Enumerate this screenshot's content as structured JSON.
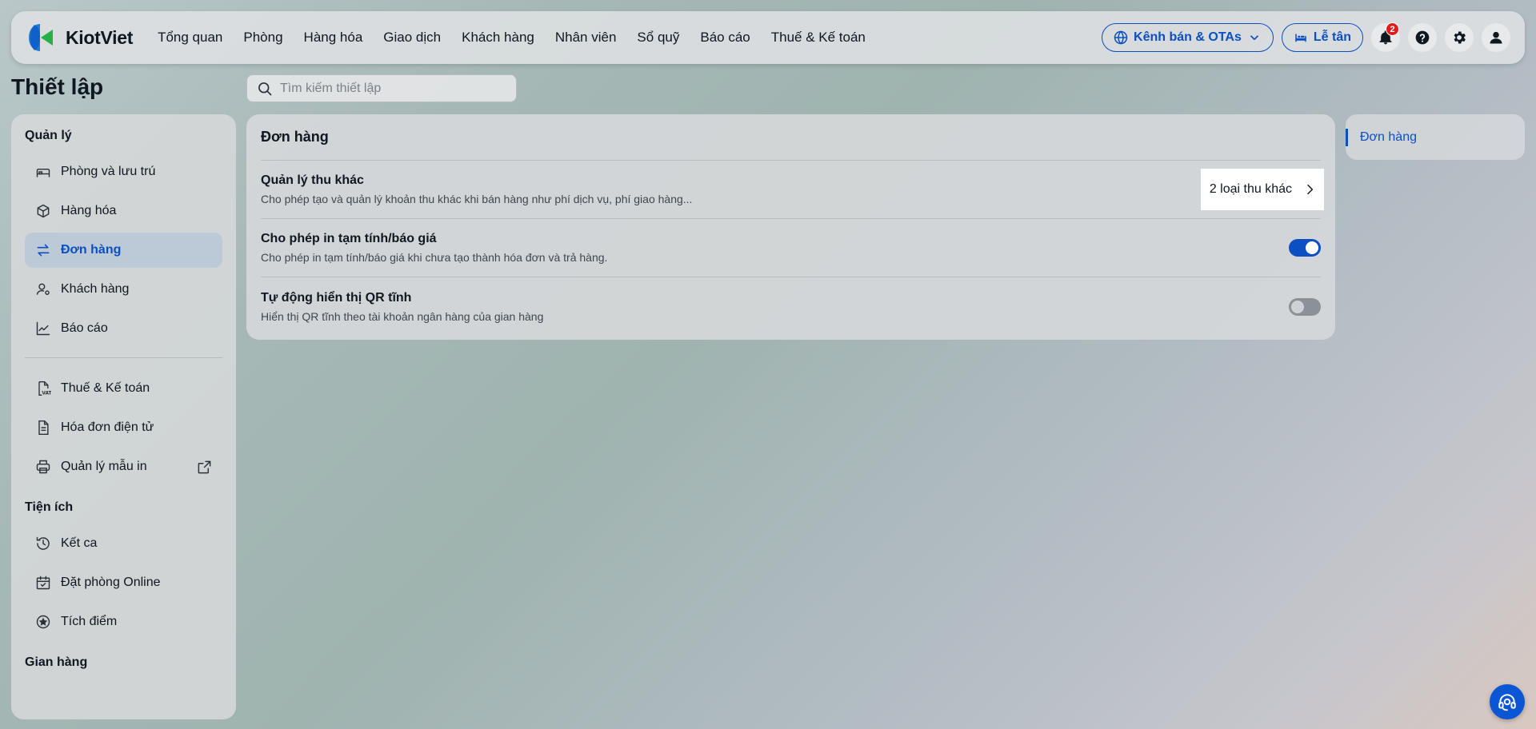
{
  "app": {
    "name": "KiotViet"
  },
  "nav": {
    "items": [
      "Tổng quan",
      "Phòng",
      "Hàng hóa",
      "Giao dịch",
      "Khách hàng",
      "Nhân viên",
      "Sổ quỹ",
      "Báo cáo",
      "Thuế & Kế toán"
    ],
    "channel_button": "Kênh bán & OTAs",
    "reception_button": "Lễ tân",
    "notification_count": "2"
  },
  "page": {
    "title": "Thiết lập",
    "search_placeholder": "Tìm kiếm thiết lập"
  },
  "sidebar": {
    "section_manage": "Quản lý",
    "manage_items": [
      "Phòng và lưu trú",
      "Hàng hóa",
      "Đơn hàng",
      "Khách hàng",
      "Báo cáo"
    ],
    "other_items": [
      "Thuế & Kế toán",
      "Hóa đơn điện tử",
      "Quản lý mẫu in"
    ],
    "section_utility": "Tiện ích",
    "utility_items": [
      "Kết ca",
      "Đặt phòng Online",
      "Tích điểm"
    ],
    "section_store": "Gian hàng"
  },
  "main": {
    "header": "Đơn hàng",
    "rows": [
      {
        "title": "Quản lý thu khác",
        "desc": "Cho phép tạo và quản lý khoản thu khác khi bán hàng như phí dịch vụ, phí giao hàng...",
        "action": "2 loại thu khác"
      },
      {
        "title": "Cho phép in tạm tính/báo giá",
        "desc": "Cho phép in tạm tính/báo giá khi chưa tạo thành hóa đơn và trả hàng.",
        "toggle": true
      },
      {
        "title": "Tự động hiển thị QR tĩnh",
        "desc": "Hiển thị QR tĩnh theo tài khoản ngân hàng của gian hàng",
        "toggle": false
      }
    ]
  },
  "toc": {
    "items": [
      "Đơn hàng"
    ]
  },
  "colors": {
    "accent": "#0b4fc2",
    "badge": "#e01b1b"
  }
}
